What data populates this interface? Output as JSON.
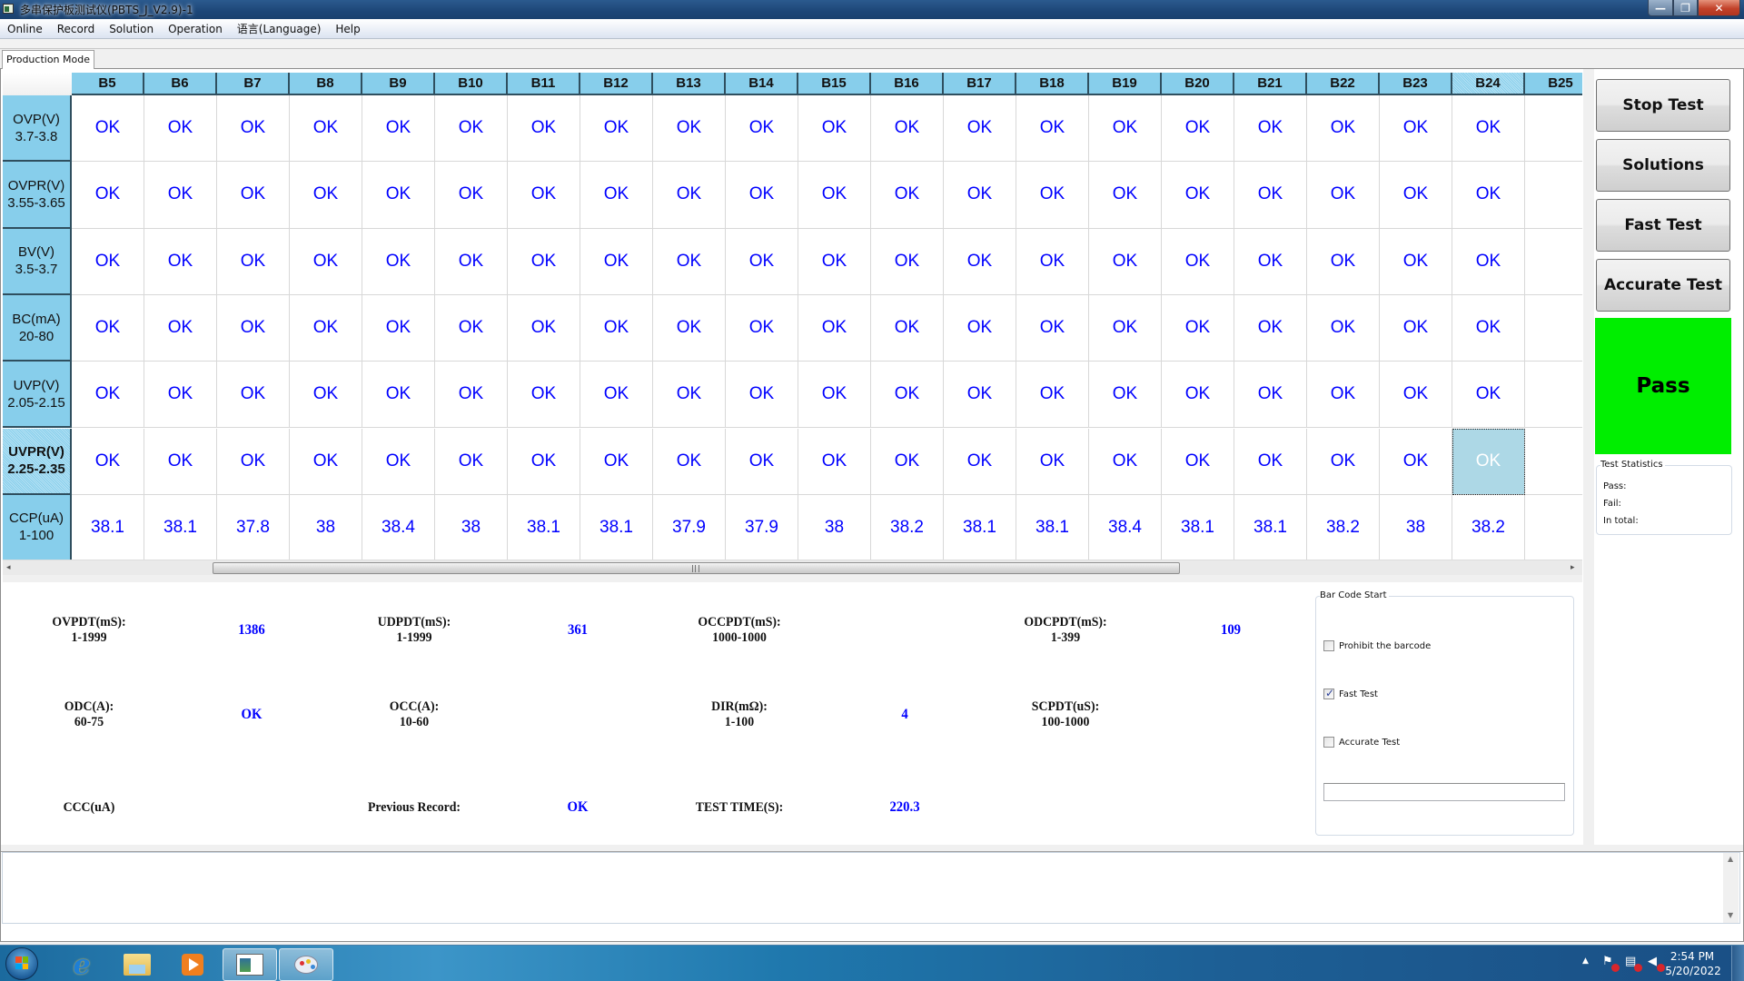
{
  "window": {
    "title": "多串保护板测试仪(PBTS_J_V2.9)-1",
    "controls": {
      "minimize": "—",
      "maximize": "❐",
      "close": "✕"
    }
  },
  "menu": [
    "Online",
    "Record",
    "Solution",
    "Operation",
    "语言(Language)",
    "Help"
  ],
  "tabs": [
    {
      "label": "Production Mode",
      "active": true
    }
  ],
  "grid": {
    "columns": [
      "B5",
      "B6",
      "B7",
      "B8",
      "B9",
      "B10",
      "B11",
      "B12",
      "B13",
      "B14",
      "B15",
      "B16",
      "B17",
      "B18",
      "B19",
      "B20",
      "B21",
      "B22",
      "B23",
      "B24",
      "B25"
    ],
    "selected_column": "B24",
    "selected_row": "UVPR(V)",
    "rows": [
      {
        "name": "OVP(V)",
        "range": "3.7-3.8",
        "values": [
          "OK",
          "OK",
          "OK",
          "OK",
          "OK",
          "OK",
          "OK",
          "OK",
          "OK",
          "OK",
          "OK",
          "OK",
          "OK",
          "OK",
          "OK",
          "OK",
          "OK",
          "OK",
          "OK",
          "OK",
          ""
        ]
      },
      {
        "name": "OVPR(V)",
        "range": "3.55-3.65",
        "values": [
          "OK",
          "OK",
          "OK",
          "OK",
          "OK",
          "OK",
          "OK",
          "OK",
          "OK",
          "OK",
          "OK",
          "OK",
          "OK",
          "OK",
          "OK",
          "OK",
          "OK",
          "OK",
          "OK",
          "OK",
          ""
        ]
      },
      {
        "name": "BV(V)",
        "range": "3.5-3.7",
        "values": [
          "OK",
          "OK",
          "OK",
          "OK",
          "OK",
          "OK",
          "OK",
          "OK",
          "OK",
          "OK",
          "OK",
          "OK",
          "OK",
          "OK",
          "OK",
          "OK",
          "OK",
          "OK",
          "OK",
          "OK",
          ""
        ]
      },
      {
        "name": "BC(mA)",
        "range": "20-80",
        "values": [
          "OK",
          "OK",
          "OK",
          "OK",
          "OK",
          "OK",
          "OK",
          "OK",
          "OK",
          "OK",
          "OK",
          "OK",
          "OK",
          "OK",
          "OK",
          "OK",
          "OK",
          "OK",
          "OK",
          "OK",
          ""
        ]
      },
      {
        "name": "UVP(V)",
        "range": "2.05-2.15",
        "values": [
          "OK",
          "OK",
          "OK",
          "OK",
          "OK",
          "OK",
          "OK",
          "OK",
          "OK",
          "OK",
          "OK",
          "OK",
          "OK",
          "OK",
          "OK",
          "OK",
          "OK",
          "OK",
          "OK",
          "OK",
          ""
        ]
      },
      {
        "name": "UVPR(V)",
        "range": "2.25-2.35",
        "values": [
          "OK",
          "OK",
          "OK",
          "OK",
          "OK",
          "OK",
          "OK",
          "OK",
          "OK",
          "OK",
          "OK",
          "OK",
          "OK",
          "OK",
          "OK",
          "OK",
          "OK",
          "OK",
          "OK",
          "OK",
          ""
        ]
      },
      {
        "name": "CCP(uA)",
        "range": "1-100",
        "values": [
          "38.1",
          "38.1",
          "37.8",
          "38",
          "38.4",
          "38",
          "38.1",
          "38.1",
          "37.9",
          "37.9",
          "38",
          "38.2",
          "38.1",
          "38.1",
          "38.4",
          "38.1",
          "38.1",
          "38.2",
          "38",
          "38.2",
          ""
        ]
      }
    ],
    "scroll": {
      "left_arrow": "◂",
      "right_arrow": "▸"
    }
  },
  "side_buttons": [
    "Stop Test",
    "Solutions",
    "Fast Test",
    "Accurate Test"
  ],
  "result": {
    "label": "Pass",
    "color": "#00ee00"
  },
  "statistics": {
    "title": "Test Statistics",
    "items": [
      {
        "label": "Pass:",
        "value": ""
      },
      {
        "label": "Fail:",
        "value": ""
      },
      {
        "label": "In total:",
        "value": ""
      }
    ]
  },
  "parameters": [
    {
      "name": "OVPDT(mS):",
      "range": "1-1999",
      "value": "1386"
    },
    {
      "name": "UDPDT(mS):",
      "range": "1-1999",
      "value": "361"
    },
    {
      "name": "OCCPDT(mS):",
      "range": "1000-1000",
      "value": ""
    },
    {
      "name": "ODCPDT(mS):",
      "range": "1-399",
      "value": "109"
    },
    {
      "name": "ODC(A):",
      "range": "60-75",
      "value": "OK"
    },
    {
      "name": "OCC(A):",
      "range": "10-60",
      "value": ""
    },
    {
      "name": "DIR(mΩ):",
      "range": "1-100",
      "value": "4"
    },
    {
      "name": "SCPDT(uS):",
      "range": "100-1000",
      "value": ""
    },
    {
      "name": "CCC(uA)",
      "range": "",
      "value": ""
    },
    {
      "name": "Previous Record:",
      "range": "",
      "value": "OK"
    },
    {
      "name": "TEST TIME(S):",
      "range": "",
      "value": "220.3"
    }
  ],
  "barcode": {
    "title": "Bar Code Start",
    "options": [
      {
        "label": "Prohibit the barcode",
        "checked": false
      },
      {
        "label": "Fast Test",
        "checked": true
      },
      {
        "label": "Accurate Test",
        "checked": false
      }
    ],
    "input_value": ""
  },
  "log": {
    "text": "",
    "up": "▲",
    "down": "▼"
  },
  "taskbar": {
    "apps": [
      "internet-explorer",
      "file-explorer",
      "media-player",
      "pbts-app",
      "paint"
    ],
    "tray_arrow": "▲",
    "tray_icons": [
      "action-center-flag",
      "network",
      "volume"
    ],
    "time": "2:54 PM",
    "date": "5/20/2022"
  }
}
